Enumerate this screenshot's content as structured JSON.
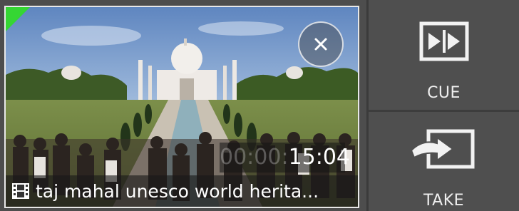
{
  "clip": {
    "title": "taj mahal unesco world herita...",
    "timecode_dim": "00:00:",
    "timecode_main": "15:04",
    "status_color": "#35d633"
  },
  "actions": {
    "cue_label": "CUE",
    "take_label": "TAKE"
  },
  "icons": {
    "close": "close-icon",
    "film": "film-icon",
    "cue": "cue-icon",
    "take": "take-icon"
  }
}
